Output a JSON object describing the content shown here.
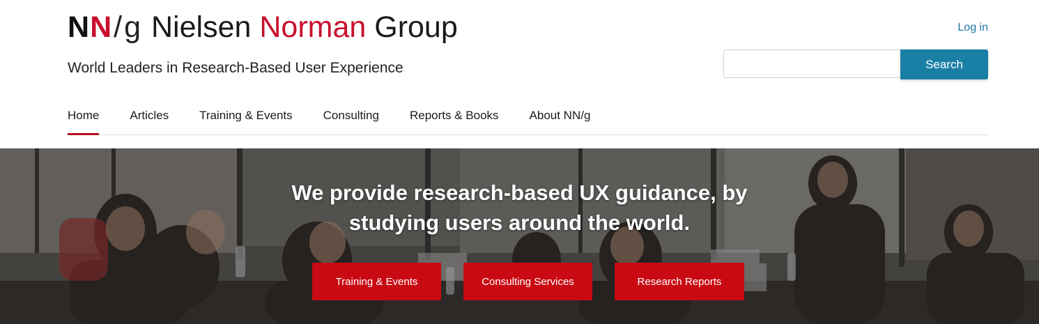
{
  "brand": {
    "mark_n1": "N",
    "mark_n2": "N",
    "mark_slash": "/",
    "mark_g": "g",
    "name_part1": "Nielsen",
    "name_part2": "Norman",
    "name_part3": "Group",
    "tagline": "World Leaders in Research-Based User Experience",
    "accent_color": "#c8102e"
  },
  "header": {
    "login_label": "Log in",
    "search": {
      "value": "",
      "placeholder": "",
      "button_label": "Search",
      "button_color": "#1a7fa4"
    }
  },
  "nav": {
    "items": [
      {
        "label": "Home",
        "active": true
      },
      {
        "label": "Articles",
        "active": false
      },
      {
        "label": "Training & Events",
        "active": false
      },
      {
        "label": "Consulting",
        "active": false
      },
      {
        "label": "Reports & Books",
        "active": false
      },
      {
        "label": "About NN/g",
        "active": false
      }
    ]
  },
  "hero": {
    "title_line1": "We provide research-based UX guidance, by",
    "title_line2": "studying users around the world.",
    "cta_buttons": [
      {
        "label": "Training & Events"
      },
      {
        "label": "Consulting Services"
      },
      {
        "label": "Research Reports"
      }
    ],
    "cta_color": "#c90a12"
  }
}
